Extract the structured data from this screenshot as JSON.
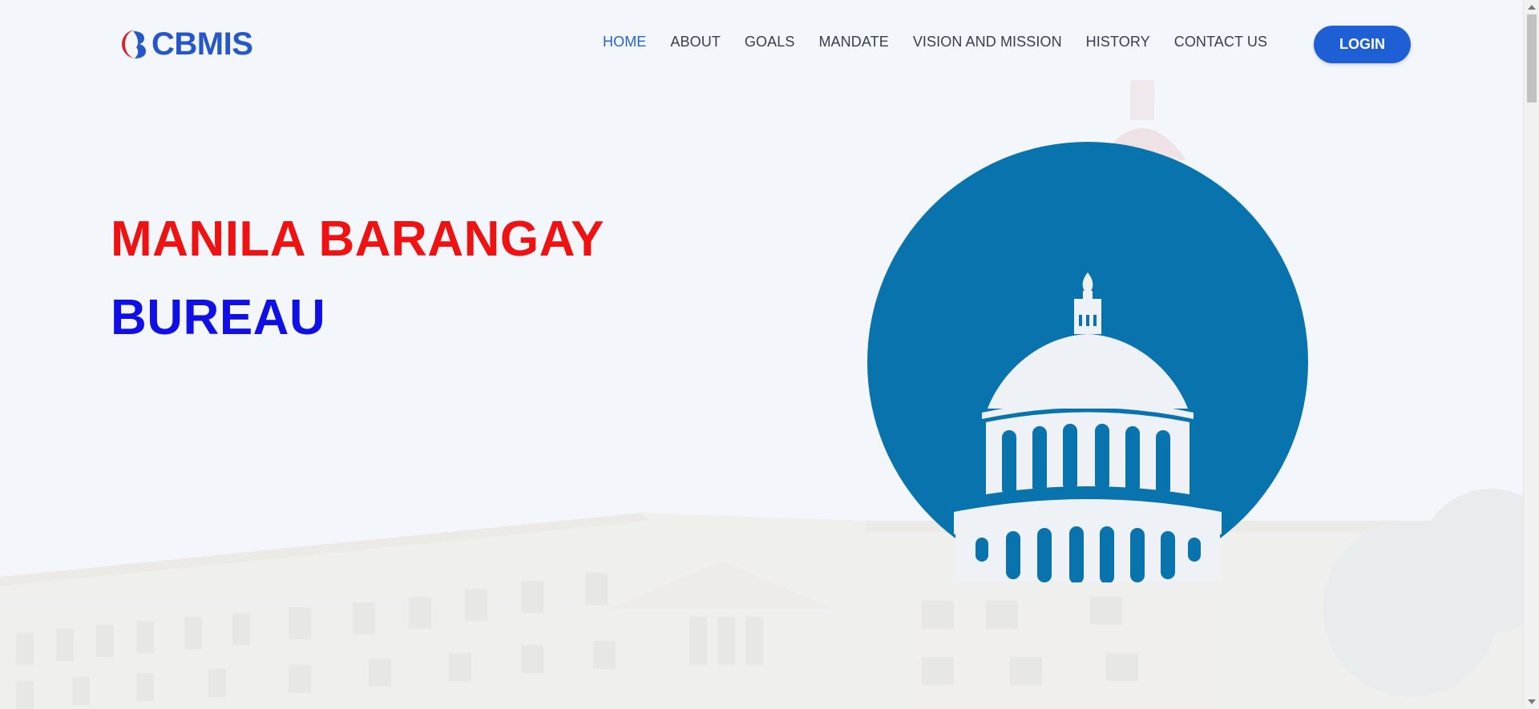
{
  "brand": {
    "name": "CBMIS",
    "logo_icon": "cbmis-logo-icon",
    "color": "#2657c9"
  },
  "nav": {
    "items": [
      {
        "label": "HOME",
        "active": true
      },
      {
        "label": "ABOUT",
        "active": false
      },
      {
        "label": "GOALS",
        "active": false
      },
      {
        "label": "MANDATE",
        "active": false
      },
      {
        "label": "VISION AND MISSION",
        "active": false
      },
      {
        "label": "HISTORY",
        "active": false
      },
      {
        "label": "CONTACT US",
        "active": false
      }
    ],
    "login_label": "LOGIN"
  },
  "hero": {
    "line1": "MANILA BARANGAY",
    "line2": "BUREAU",
    "line1_color": "#ee1212",
    "line2_color": "#1010e6",
    "emblem_icon": "capitol-dome-icon",
    "emblem_color": "#0873ad"
  },
  "colors": {
    "accent": "#1f5fd6",
    "background": "#f3f6fa"
  }
}
